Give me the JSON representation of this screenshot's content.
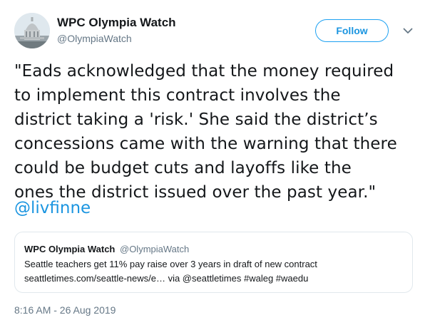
{
  "author": {
    "name": "WPC Olympia Watch",
    "handle": "@OlympiaWatch"
  },
  "follow_button": {
    "label": "Follow"
  },
  "menu": {
    "icon": "chevron-down-icon"
  },
  "tweet": {
    "text_lines": [
      "\"Eads acknowledged that the money required",
      "to implement this contract involves the",
      "district taking a 'risk.' She said the district’s",
      "concessions came with the warning that there",
      "could be budget cuts and layoffs like the",
      "ones the district issued over the past year.\""
    ],
    "mention": "@livfinne"
  },
  "quote": {
    "name": "WPC Olympia Watch",
    "handle": "@OlympiaWatch",
    "line1": "Seattle teachers get 11% pay raise over 3 years in draft of new contract",
    "line2": "seattletimes.com/seattle-news/e… via @seattletimes #waleg #waedu"
  },
  "timestamp": "8:16 AM - 26 Aug 2019",
  "colors": {
    "accent": "#1da1f2",
    "link": "#1b95e0",
    "text": "#14171a",
    "muted": "#657786",
    "border": "#e1e8ed"
  }
}
